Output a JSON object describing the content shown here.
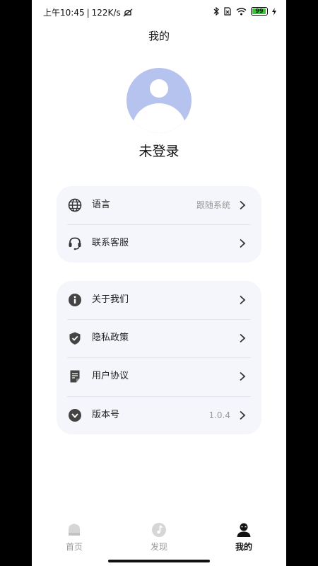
{
  "status_bar": {
    "time": "上午10:45",
    "separator": "|",
    "speed": "122K/s",
    "battery_level": "99",
    "icons": [
      "muted-alarm-icon",
      "bluetooth-icon",
      "sim-x-icon",
      "wifi-icon",
      "battery-icon",
      "charging-icon"
    ]
  },
  "header": {
    "title": "我的"
  },
  "profile": {
    "username": "未登录",
    "avatar_color": "#b7c3ef"
  },
  "settings_group_1": [
    {
      "label": "语言",
      "value": "跟随系统",
      "icon": "globe-icon"
    },
    {
      "label": "联系客服",
      "value": "",
      "icon": "headset-icon"
    }
  ],
  "settings_group_2": [
    {
      "label": "关于我们",
      "value": "",
      "icon": "info-icon"
    },
    {
      "label": "隐私政策",
      "value": "",
      "icon": "shield-check-icon"
    },
    {
      "label": "用户协议",
      "value": "",
      "icon": "document-icon"
    },
    {
      "label": "版本号",
      "value": "1.0.4",
      "icon": "chevron-circle-icon"
    }
  ],
  "bottom_nav": [
    {
      "label": "首页",
      "icon": "home-icon",
      "active": false
    },
    {
      "label": "发现",
      "icon": "music-disc-icon",
      "active": false
    },
    {
      "label": "我的",
      "icon": "user-icon",
      "active": true
    }
  ],
  "colors": {
    "card_bg": "#f4f6fc",
    "icon_dark": "#333333",
    "inactive": "#9a9a9a"
  }
}
